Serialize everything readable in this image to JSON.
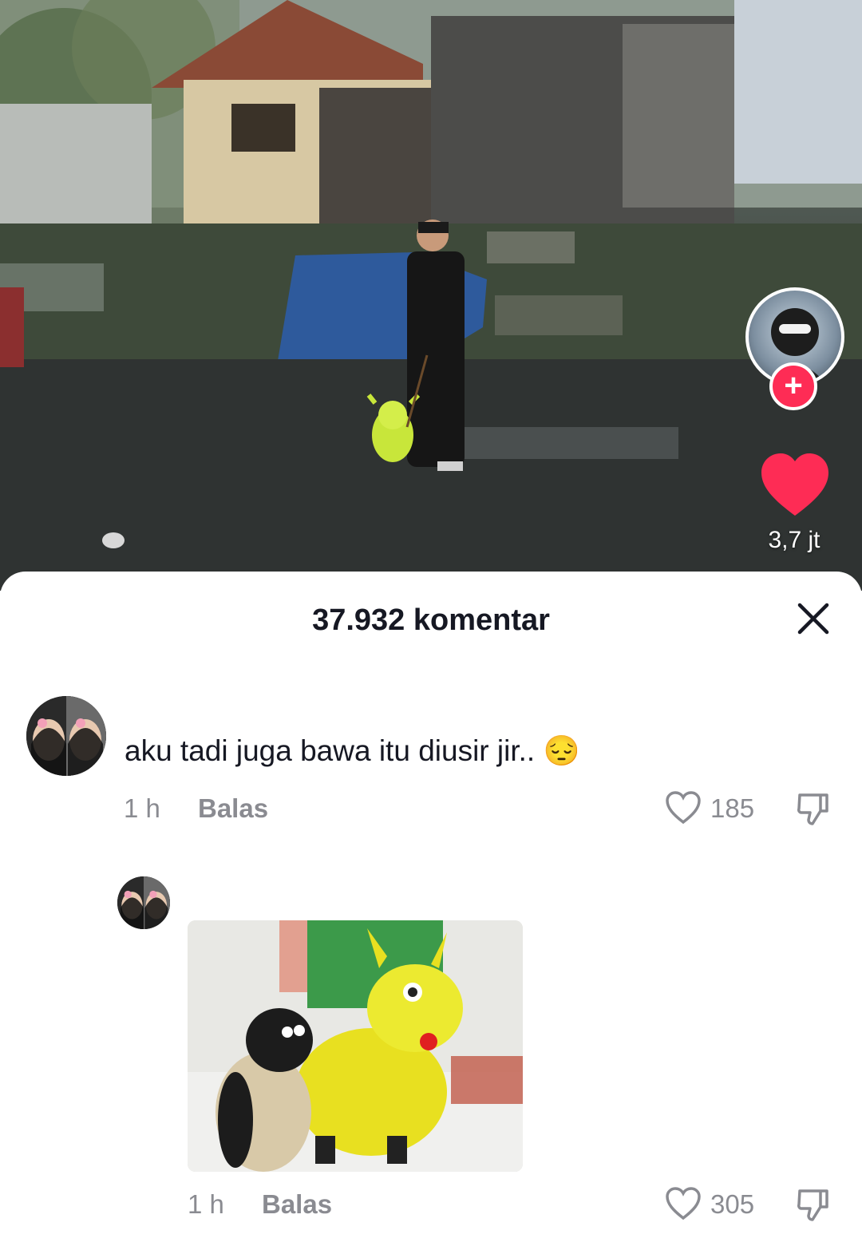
{
  "video": {
    "like_count": "3,7 jt",
    "colors": {
      "like": "#fe2c55",
      "follow": "#fe2c55"
    }
  },
  "comments_sheet": {
    "title": "37.932 komentar",
    "comments": [
      {
        "text": "aku tadi juga bawa itu diusir jir.. 😔",
        "time": "1 h",
        "reply_label": "Balas",
        "likes": "185"
      },
      {
        "time": "1 h",
        "reply_label": "Balas",
        "likes": "305",
        "has_image": true
      }
    ]
  },
  "icons": [
    "close-icon",
    "heart-outline-icon",
    "dislike-icon",
    "heart-filled-icon",
    "plus-icon"
  ]
}
